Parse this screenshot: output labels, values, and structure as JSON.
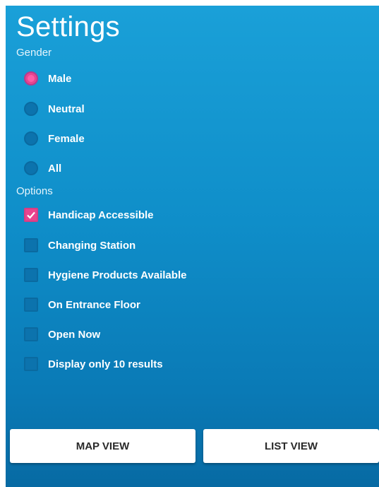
{
  "header": {
    "title": "Settings"
  },
  "gender": {
    "label": "Gender",
    "options": [
      {
        "label": "Male",
        "selected": true
      },
      {
        "label": "Neutral",
        "selected": false
      },
      {
        "label": "Female",
        "selected": false
      },
      {
        "label": "All",
        "selected": false
      }
    ]
  },
  "options": {
    "label": "Options",
    "items": [
      {
        "label": "Handicap Accessible",
        "checked": true
      },
      {
        "label": "Changing Station",
        "checked": false
      },
      {
        "label": "Hygiene Products Available",
        "checked": false
      },
      {
        "label": "On Entrance Floor",
        "checked": false
      },
      {
        "label": "Open Now",
        "checked": false
      },
      {
        "label": "Display only 10 results",
        "checked": false
      }
    ]
  },
  "footer": {
    "map_view_label": "MAP VIEW",
    "list_view_label": "LIST VIEW"
  },
  "colors": {
    "accent": "#e8458f",
    "background": "#0f8ec9"
  }
}
